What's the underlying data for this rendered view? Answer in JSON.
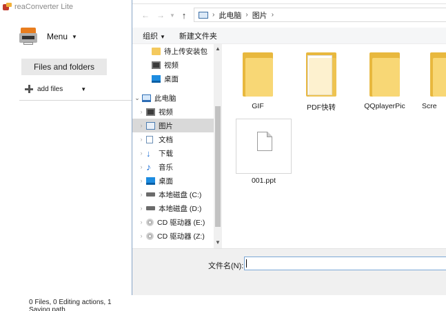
{
  "app": {
    "title": "reaConverter Lite",
    "menu_label": "Menu",
    "files_button": "Files and folders",
    "add_files": "add files",
    "status": "0 Files, 0 Editing actions, 1 Saving path"
  },
  "dialog": {
    "breadcrumb": [
      "此电脑",
      "图片"
    ],
    "toolbar": {
      "organize": "组织",
      "new_folder": "新建文件夹"
    },
    "tree": [
      {
        "label": "待上传安装包",
        "icon": "folder-icon"
      },
      {
        "label": "视频",
        "icon": "video-icon"
      },
      {
        "label": "桌面",
        "icon": "desktop-icon"
      },
      {
        "label": "此电脑",
        "icon": "computer-icon"
      },
      {
        "label": "视频",
        "icon": "video-icon"
      },
      {
        "label": "图片",
        "icon": "pictures-icon",
        "selected": true
      },
      {
        "label": "文档",
        "icon": "document-icon"
      },
      {
        "label": "下载",
        "icon": "download-icon"
      },
      {
        "label": "音乐",
        "icon": "music-icon"
      },
      {
        "label": "桌面",
        "icon": "desktop-icon"
      },
      {
        "label": "本地磁盘 (C:)",
        "icon": "drive-icon"
      },
      {
        "label": "本地磁盘 (D:)",
        "icon": "drive-icon"
      },
      {
        "label": "CD 驱动器 (E:)",
        "icon": "cd-drive-icon"
      },
      {
        "label": "CD 驱动器 (Z:)",
        "icon": "cd-drive-icon"
      }
    ],
    "items": [
      {
        "name": "GIF",
        "type": "folder"
      },
      {
        "name": "PDF快转",
        "type": "folder"
      },
      {
        "name": "QQplayerPic",
        "type": "folder"
      },
      {
        "name": "Scre",
        "type": "folder"
      }
    ],
    "file": {
      "name": "001.ppt"
    },
    "filename_label": "文件名(N):",
    "filename_value": ""
  }
}
